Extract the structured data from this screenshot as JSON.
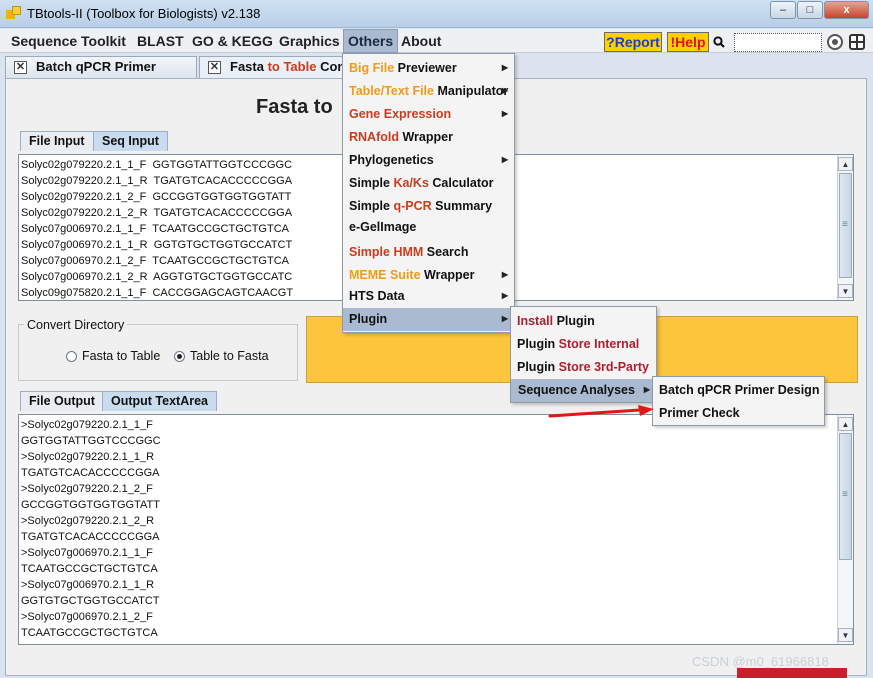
{
  "window": {
    "title": "TBtools-II (Toolbox for Biologists) v2.138",
    "controls": {
      "minimize": "–",
      "maximize": "□",
      "close": "x"
    }
  },
  "menubar": {
    "items": [
      "Sequence Toolkit",
      "BLAST",
      "GO & KEGG",
      "Graphics",
      "Others",
      "About"
    ],
    "report": "?Report",
    "help": "!Help"
  },
  "doc_tabs": [
    {
      "pre": "Batch qPCR Primer Design"
    },
    {
      "pre": "Fasta ",
      "accent": "to Table",
      "post": " Conve"
    }
  ],
  "heading": "Fasta to",
  "input_tabs": [
    "File Input",
    "Seq Input"
  ],
  "input_lines": [
    "Solyc02g079220.2.1_1_F  GGTGGTATTGGTCCCGGC",
    "Solyc02g079220.2.1_1_R  TGATGTCACACCCCCGGA",
    "Solyc02g079220.2.1_2_F  GCCGGTGGTGGTGGTATT",
    "Solyc02g079220.2.1_2_R  TGATGTCACACCCCCGGA",
    "Solyc07g006970.2.1_1_F  TCAATGCCGCTGCTGTCA",
    "Solyc07g006970.2.1_1_R  GGTGTGCTGGTGCCATCT",
    "Solyc07g006970.2.1_2_F  TCAATGCCGCTGCTGTCA",
    "Solyc07g006970.2.1_2_R  AGGTGTGCTGGTGCCATC",
    "Solyc09g075820.2.1_1_F  CACCGGAGCAGTCAACGT"
  ],
  "convert": {
    "title": "Convert Directory",
    "option1": "Fasta to Table",
    "option2": "Table to Fasta",
    "selected": "Table to Fasta"
  },
  "output_tabs": [
    "File Output",
    "Output TextArea"
  ],
  "output_lines": [
    ">Solyc02g079220.2.1_1_F",
    "GGTGGTATTGGTCCCGGC",
    ">Solyc02g079220.2.1_1_R",
    "TGATGTCACACCCCCGGA",
    ">Solyc02g079220.2.1_2_F",
    "GCCGGTGGTGGTGGTATT",
    ">Solyc02g079220.2.1_2_R",
    "TGATGTCACACCCCCGGA",
    ">Solyc07g006970.2.1_1_F",
    "TCAATGCCGCTGCTGTCA",
    ">Solyc07g006970.2.1_1_R",
    "GGTGTGCTGGTGCCATCT",
    ">Solyc07g006970.2.1_2_F",
    "TCAATGCCGCTGCTGTCA"
  ],
  "others_menu": [
    {
      "a": "Big File",
      "b": " Previewer",
      "a_color": "orange",
      "submenu": true
    },
    {
      "a": "Table/Text File",
      "b": " Manipulator",
      "a_color": "orange",
      "submenu": true
    },
    {
      "a": "Gene Expression",
      "b": "",
      "a_color": "red",
      "submenu": true
    },
    {
      "a": "RNAfold",
      "b": " Wrapper",
      "a_color": "red",
      "submenu": false
    },
    {
      "a": "",
      "b": "Phylogenetics",
      "a_color": "",
      "submenu": true
    },
    {
      "a": "Simple ",
      "b": "Ka/Ks",
      "c": " Calculator",
      "mode": "mid"
    },
    {
      "a": "Simple ",
      "b": "q-PCR",
      "c": " Summary",
      "mode": "mid"
    },
    {
      "a": "",
      "b": "e-GelImage",
      "a_color": "",
      "submenu": false
    },
    {
      "a": "Simple HMM",
      "b": " Search",
      "a_color": "red",
      "submenu": false
    },
    {
      "a": "MEME Suite",
      "b": " Wrapper",
      "a_color": "orange",
      "submenu": true
    },
    {
      "a": "",
      "b": "HTS Data",
      "a_color": "",
      "submenu": true
    },
    {
      "a": "",
      "b": "Plugin",
      "a_color": "",
      "submenu": true
    }
  ],
  "plugin_menu": {
    "install_a": "Install",
    "install_b": " Plugin",
    "store_internal_a": "Plugin ",
    "store_internal_b": "Store Internal",
    "store_3rd_a": "Plugin ",
    "store_3rd_b": "Store 3rd-Party",
    "sequence_analyses": "Sequence Analyses"
  },
  "seq_analyses_menu": [
    "Batch qPCR Primer Design",
    "Primer Check"
  ],
  "watermark": "CSDN @m0_61966818",
  "colors": {
    "orange": "#f39a1b",
    "red": "#cc3b1e",
    "darkred": "#b01e2e",
    "highlight": "#a9bad1",
    "banner": "#fdc53b"
  }
}
